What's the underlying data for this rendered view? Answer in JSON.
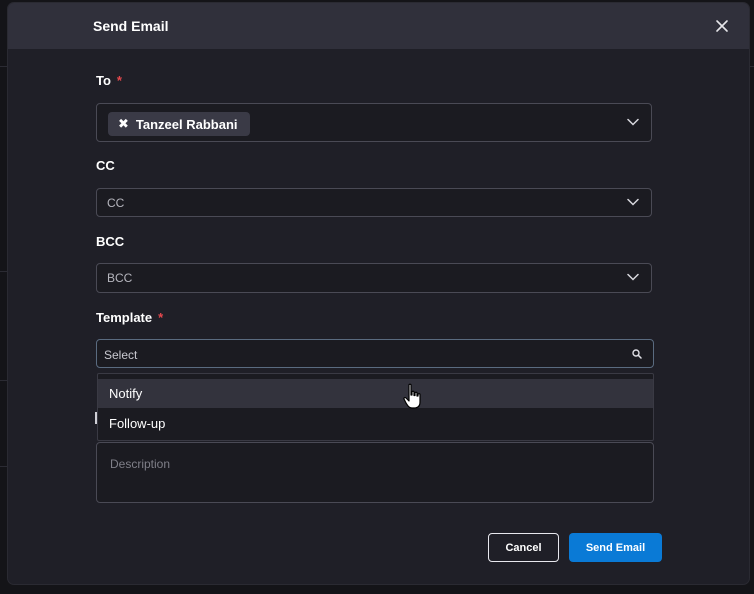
{
  "modal": {
    "title": "Send Email",
    "close_icon": "close-icon"
  },
  "fields": {
    "to": {
      "label": "To",
      "required_mark": "*",
      "chips": [
        {
          "label": "Tanzeel Rabbani",
          "remove_symbol": "✖"
        }
      ]
    },
    "cc": {
      "label": "CC",
      "placeholder": "CC"
    },
    "bcc": {
      "label": "BCC",
      "placeholder": "BCC"
    },
    "template": {
      "label": "Template",
      "required_mark": "*",
      "placeholder": "Select",
      "options": [
        "Notify",
        "Follow-up"
      ],
      "hovered_option": "Notify"
    },
    "description": {
      "placeholder": "Description"
    }
  },
  "buttons": {
    "cancel": "Cancel",
    "send": "Send Email"
  },
  "colors": {
    "primary": "#0a7ad6",
    "required": "#e5484d",
    "modal_bg": "#1f1f27",
    "header_bg": "#30303b"
  }
}
